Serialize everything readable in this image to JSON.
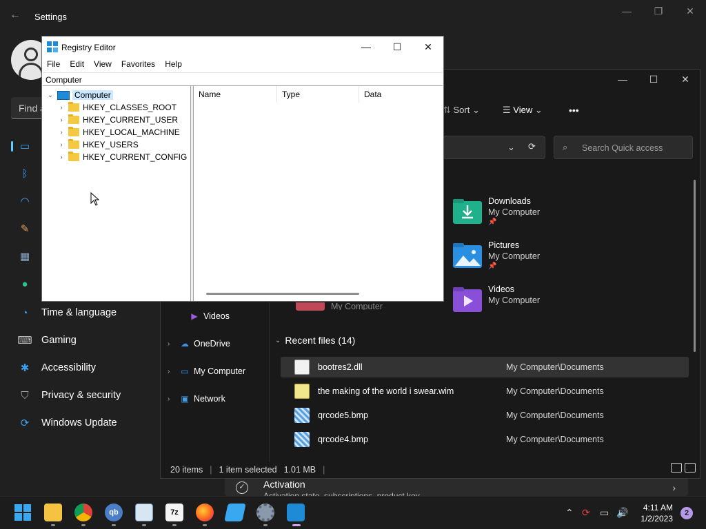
{
  "settings": {
    "title": "Settings",
    "search_placeholder": "Find a",
    "nav": [
      {
        "label": "",
        "icon": "display-icon"
      },
      {
        "label": "",
        "icon": "bluetooth-icon"
      },
      {
        "label": "",
        "icon": "wifi-icon"
      },
      {
        "label": "",
        "icon": "brush-icon"
      },
      {
        "label": "",
        "icon": "apps-icon"
      },
      {
        "label": "",
        "icon": "person-icon"
      },
      {
        "label": "Time & language",
        "icon": "clock-globe-icon"
      },
      {
        "label": "Gaming",
        "icon": "gamepad-icon"
      },
      {
        "label": "Accessibility",
        "icon": "accessibility-icon"
      },
      {
        "label": "Privacy & security",
        "icon": "shield-icon"
      },
      {
        "label": "Windows Update",
        "icon": "update-icon"
      }
    ],
    "activation": {
      "title": "Activation",
      "subtitle": "Activation state, subscriptions, product key"
    }
  },
  "explorer": {
    "toolbar": {
      "sort": "Sort",
      "view": "View",
      "more": "•••"
    },
    "search_placeholder": "Search Quick access",
    "quick_access": [
      {
        "name": "Downloads",
        "location": "My Computer",
        "color": "#1fb08c"
      },
      {
        "name": "Pictures",
        "location": "My Computer",
        "color": "#2a8fe0"
      },
      {
        "name": "Videos",
        "location": "My Computer",
        "color": "#8a4fd8"
      }
    ],
    "partial_location": "My Computer",
    "left_tree": [
      {
        "label": "Videos"
      },
      {
        "label": "OneDrive"
      },
      {
        "label": "My Computer"
      },
      {
        "label": "Network"
      }
    ],
    "recent_header": "Recent files (14)",
    "recent_files": [
      {
        "name": "bootres2.dll",
        "path": "My Computer\\Documents",
        "selected": true
      },
      {
        "name": "the making of the world i swear.wim",
        "path": "My Computer\\Documents",
        "selected": false
      },
      {
        "name": "qrcode5.bmp",
        "path": "My Computer\\Documents",
        "selected": false
      },
      {
        "name": "qrcode4.bmp",
        "path": "My Computer\\Documents",
        "selected": false
      }
    ],
    "status": {
      "items": "20 items",
      "selected": "1 item selected",
      "size": "1.01 MB"
    }
  },
  "regedit": {
    "title": "Registry Editor",
    "menu": [
      "File",
      "Edit",
      "View",
      "Favorites",
      "Help"
    ],
    "address": "Computer",
    "root": "Computer",
    "hives": [
      "HKEY_CLASSES_ROOT",
      "HKEY_CURRENT_USER",
      "HKEY_LOCAL_MACHINE",
      "HKEY_USERS",
      "HKEY_CURRENT_CONFIG"
    ],
    "columns": [
      "Name",
      "Type",
      "Data"
    ]
  },
  "taskbar": {
    "apps": [
      {
        "icon": "start-icon",
        "label": ""
      },
      {
        "icon": "file-explorer-icon",
        "label": ""
      },
      {
        "icon": "chrome-icon",
        "label": ""
      },
      {
        "icon": "qbittorrent-icon",
        "label": "qb"
      },
      {
        "icon": "resource-monitor-icon",
        "label": ""
      },
      {
        "icon": "7zip-icon",
        "label": "7z"
      },
      {
        "icon": "firefox-icon",
        "label": ""
      },
      {
        "icon": "drive-icon",
        "label": ""
      },
      {
        "icon": "settings-icon",
        "label": ""
      },
      {
        "icon": "regedit-icon",
        "label": ""
      }
    ],
    "time": "4:11 AM",
    "date": "1/2/2023",
    "notification_count": "2"
  }
}
